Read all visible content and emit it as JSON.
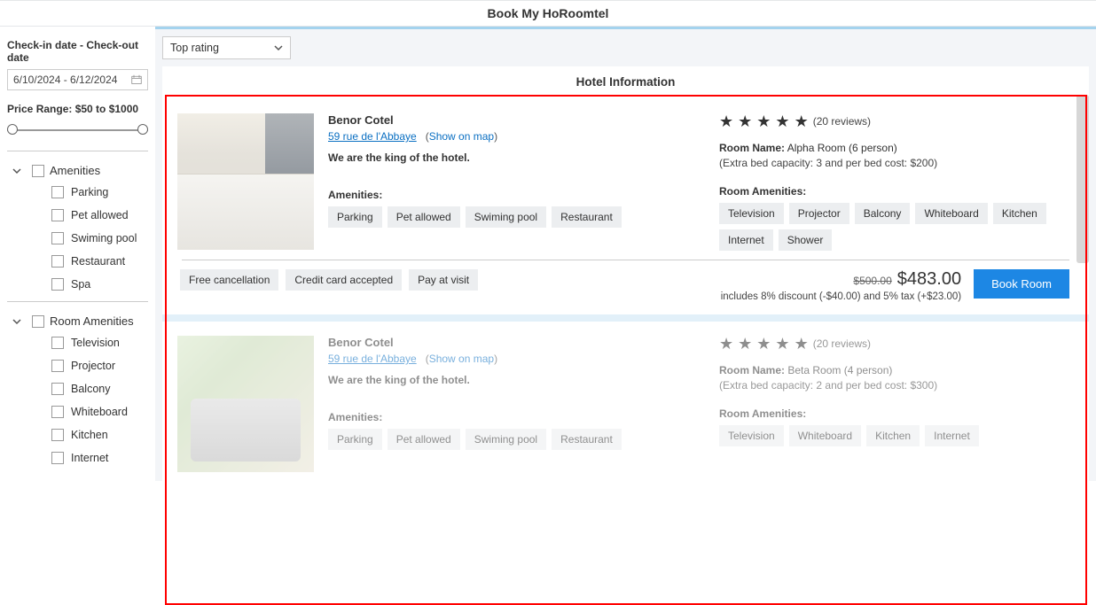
{
  "header_title": "Book My HoRoomtel",
  "sidebar": {
    "date_label": "Check-in date - Check-out date",
    "date_value": "6/10/2024 - 6/12/2024",
    "price_label": "Price Range: $50 to $1000",
    "amenities_label": "Amenities",
    "amenities": [
      "Parking",
      "Pet allowed",
      "Swiming pool",
      "Restaurant",
      "Spa"
    ],
    "room_amenities_label": "Room Amenities",
    "room_amenities": [
      "Television",
      "Projector",
      "Balcony",
      "Whiteboard",
      "Kitchen",
      "Internet"
    ]
  },
  "sort_value": "Top rating",
  "panel_title": "Hotel Information",
  "listings": [
    {
      "name": "Benor Cotel",
      "address": "59 rue de l'Abbaye",
      "show_on_map": "Show on map",
      "tagline": "We are the king of the hotel.",
      "amenities_label": "Amenities:",
      "amenities": [
        "Parking",
        "Pet allowed",
        "Swiming pool",
        "Restaurant"
      ],
      "reviews": "(20 reviews)",
      "room_name_label": "Room Name:",
      "room_name_rest": " Alpha Room (6 person)",
      "extra": "(Extra bed capacity: 3 and per bed cost: $200)",
      "room_amen_label": "Room Amenities:",
      "room_amenities": [
        "Television",
        "Projector",
        "Balcony",
        "Whiteboard",
        "Kitchen",
        "Internet",
        "Shower"
      ],
      "policies": [
        "Free cancellation",
        "Credit card accepted",
        "Pay at visit"
      ],
      "orig_price": "$500.00",
      "price": "$483.00",
      "price_note": "includes 8% discount (-$40.00) and 5% tax (+$23.00)",
      "book_label": "Book Room"
    },
    {
      "name": "Benor Cotel",
      "address": "59 rue de l'Abbaye",
      "show_on_map": "Show on map",
      "tagline": "We are the king of the hotel.",
      "amenities_label": "Amenities:",
      "amenities": [
        "Parking",
        "Pet allowed",
        "Swiming pool",
        "Restaurant"
      ],
      "reviews": "(20 reviews)",
      "room_name_label": "Room Name:",
      "room_name_rest": " Beta Room (4 person)",
      "extra": "(Extra bed capacity: 2 and per bed cost: $300)",
      "room_amen_label": "Room Amenities:",
      "room_amenities": [
        "Television",
        "Whiteboard",
        "Kitchen",
        "Internet"
      ]
    }
  ]
}
